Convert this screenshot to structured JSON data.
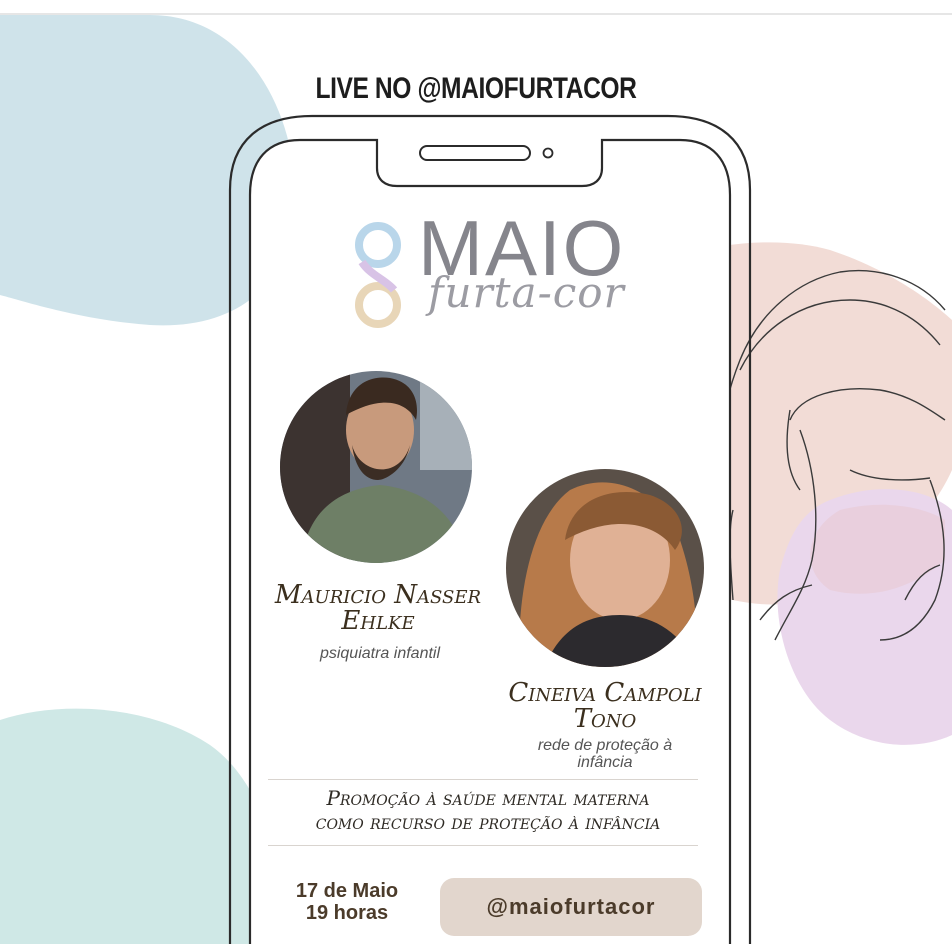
{
  "header": {
    "title": "LIVE NO @MAIOFURTACOR"
  },
  "logo": {
    "word": "MAIO",
    "tagline": "furta-cor"
  },
  "speakers": [
    {
      "name_line1": "Mauricio Nasser",
      "name_line2": "Ehlke",
      "role_line1": "psiquiatra infantil",
      "role_line2": ""
    },
    {
      "name_line1": "Cineiva Campoli",
      "name_line2": "Tono",
      "role_line1": "rede de proteção à",
      "role_line2": "infância"
    }
  ],
  "topic": {
    "line1": "Promoção à saúde mental materna",
    "line2": "como recurso de proteção à infância"
  },
  "event": {
    "date": "17 de Maio",
    "time": "19 horas",
    "handle": "@maiofurtacor"
  },
  "colors": {
    "blob_blue": "#cfe3ea",
    "blob_peach": "#f2dcd6",
    "blob_lilac": "#ead7ec",
    "blob_teal": "#cfe8e6",
    "pill": "#e2d6cd",
    "text_brown": "#4b3b2a"
  },
  "icons": {
    "logo_mark": "infinity-eight-icon",
    "speaker_line_art": "face-line-art"
  }
}
